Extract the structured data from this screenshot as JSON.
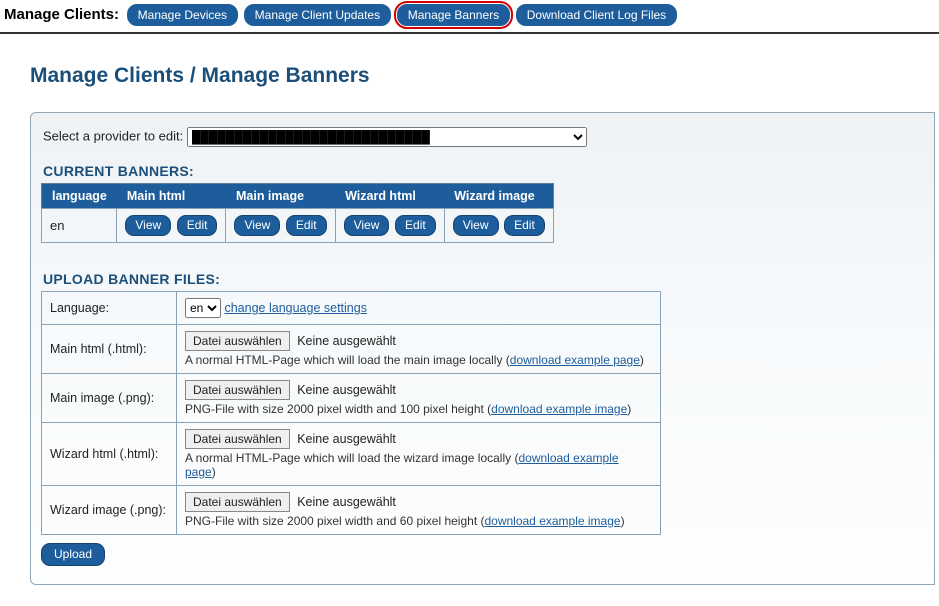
{
  "topbar": {
    "label": "Manage Clients:",
    "tabs": [
      {
        "label": "Manage Devices"
      },
      {
        "label": "Manage Client Updates"
      },
      {
        "label": "Manage Banners",
        "highlight": true
      },
      {
        "label": "Download Client Log Files"
      }
    ]
  },
  "page": {
    "title": "Manage Clients / Manage Banners"
  },
  "provider": {
    "label": "Select a provider to edit:",
    "selected": "████████████████████████████"
  },
  "current_banners": {
    "heading": "CURRENT BANNERS:",
    "columns": [
      "language",
      "Main html",
      "Main image",
      "Wizard html",
      "Wizard image"
    ],
    "row": {
      "language": "en",
      "view": "View",
      "edit": "Edit"
    }
  },
  "upload": {
    "heading": "UPLOAD BANNER FILES:",
    "language_label": "Language:",
    "language_value": "en",
    "change_link": "change language settings",
    "file_button": "Datei auswählen",
    "file_status": "Keine ausgewählt",
    "rows": [
      {
        "label": "Main html (.html):",
        "hint_pre": "A normal HTML-Page which will load the main image locally (",
        "hint_link": "download example page",
        "hint_post": ")"
      },
      {
        "label": "Main image (.png):",
        "hint_pre": "PNG-File with size 2000 pixel width and 100 pixel height (",
        "hint_link": "download example image",
        "hint_post": ")"
      },
      {
        "label": "Wizard html (.html):",
        "hint_pre": "A normal HTML-Page which will load the wizard image locally (",
        "hint_link": "download example page",
        "hint_post": ")"
      },
      {
        "label": "Wizard image (.png):",
        "hint_pre": "PNG-File with size 2000 pixel width and 60 pixel height (",
        "hint_link": "download example image",
        "hint_post": ")"
      }
    ],
    "submit": "Upload"
  }
}
